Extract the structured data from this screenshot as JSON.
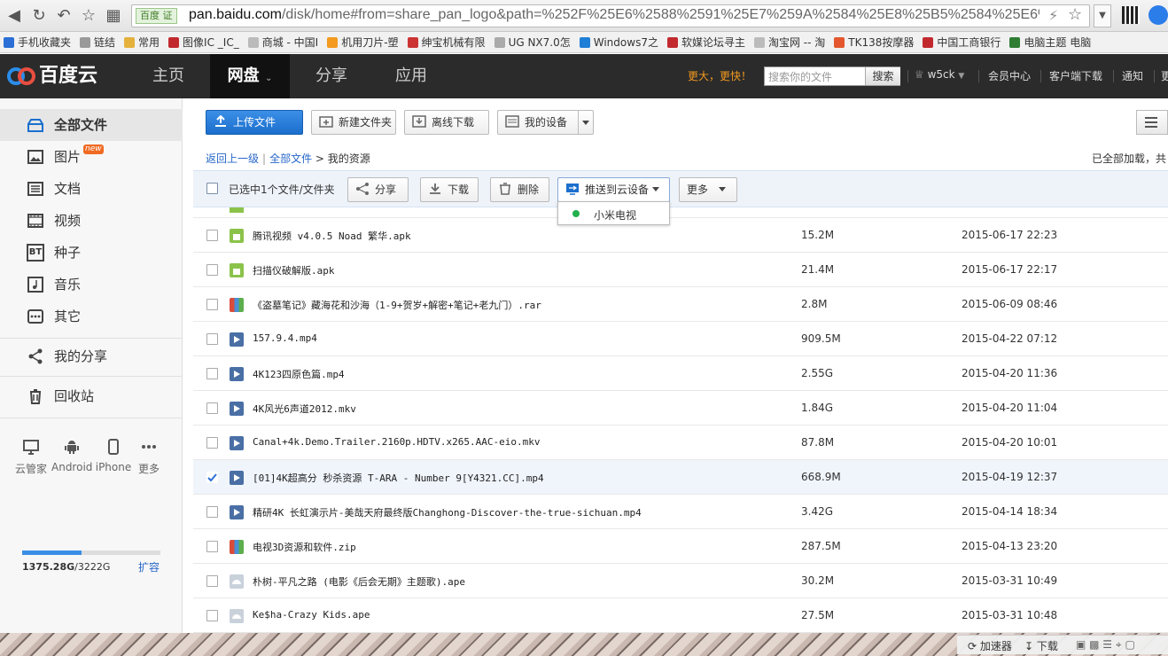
{
  "browser": {
    "url_badge": "百度 证",
    "url_host": "pan.baidu.com",
    "url_rest": "/disk/home#from=share_pan_logo&path=%252F%25E6%2588%2591%25E7%259A%2584%25E8%25B5%2584%25E6%",
    "bookmarks": [
      "手机收藏夹",
      "链结",
      "常用",
      "图像IC _IC_",
      "商城 - 中国I",
      "机用刀片-塑",
      "绅宝机械有限",
      "UG NX7.0怎",
      "Windows7之",
      "软媒论坛寻主",
      "淘宝网 -- 淘",
      "TK138按摩器",
      "中国工商银行",
      "电脑主题 电脑"
    ]
  },
  "header": {
    "logo_text": "百度云",
    "nav": [
      "主页",
      "网盘",
      "分享",
      "应用"
    ],
    "active_nav": "网盘",
    "promo": "更大，更快！",
    "search_placeholder": "搜索你的文件",
    "search_button": "搜索",
    "username": "w5ck",
    "links": [
      "会员中心",
      "客户端下载",
      "通知",
      "更"
    ]
  },
  "sidebar": {
    "items": [
      {
        "label": "全部文件",
        "icon": "folder-icon",
        "active": true
      },
      {
        "label": "图片",
        "icon": "image-icon",
        "badge": "new"
      },
      {
        "label": "文档",
        "icon": "document-icon"
      },
      {
        "label": "视频",
        "icon": "video-icon"
      },
      {
        "label": "种子",
        "icon": "bt-icon",
        "icon_text": "BT"
      },
      {
        "label": "音乐",
        "icon": "music-icon"
      },
      {
        "label": "其它",
        "icon": "more-icon"
      }
    ],
    "share": "我的分享",
    "trash": "回收站",
    "devices": [
      "云管家",
      "Android",
      "iPhone",
      "更多"
    ],
    "quota_used": "1375.28G",
    "quota_total": "/3222G",
    "quota_fraction": 0.427,
    "expand": "扩容"
  },
  "toolbar": {
    "upload": "上传文件",
    "new_folder": "新建文件夹",
    "offline": "离线下载",
    "my_devices": "我的设备"
  },
  "breadcrumb": {
    "back": "返回上一级",
    "all": "全部文件",
    "sep": ">",
    "current": "我的资源",
    "loaded": "已全部加载，共"
  },
  "actionbar": {
    "selected": "已选中1个文件/文件夹",
    "share": "分享",
    "download": "下载",
    "delete": "删除",
    "push": "推送到云设备",
    "more": "更多"
  },
  "push_menu": {
    "item": "小米电视"
  },
  "files": [
    {
      "name": "腾讯视频 v4.0.5 Noad 繁华.apk",
      "size": "15.2M",
      "date": "2015-06-17 22:23",
      "type": "apk",
      "checked": false
    },
    {
      "name": "扫描仪破解版.apk",
      "size": "21.4M",
      "date": "2015-06-17 22:17",
      "type": "apk",
      "checked": false
    },
    {
      "name": "《盗墓笔记》藏海花和沙海（1-9+贺岁+解密+笔记+老九门）.rar",
      "size": "2.8M",
      "date": "2015-06-09 08:46",
      "type": "archive",
      "checked": false
    },
    {
      "name": "157.9.4.mp4",
      "size": "909.5M",
      "date": "2015-04-22 07:12",
      "type": "video",
      "checked": false
    },
    {
      "name": "4K123四原色篇.mp4",
      "size": "2.55G",
      "date": "2015-04-20 11:36",
      "type": "video",
      "checked": false
    },
    {
      "name": "4K风光6声道2012.mkv",
      "size": "1.84G",
      "date": "2015-04-20 11:04",
      "type": "video",
      "checked": false
    },
    {
      "name": "Canal+4k.Demo.Trailer.2160p.HDTV.x265.AAC-eio.mkv",
      "size": "87.8M",
      "date": "2015-04-20 10:01",
      "type": "video",
      "checked": false
    },
    {
      "name": "[01]4K超高分 秒杀资源 T-ARA - Number 9[Y4321.CC].mp4",
      "size": "668.9M",
      "date": "2015-04-19 12:37",
      "type": "video",
      "checked": true
    },
    {
      "name": "精研4K 长虹演示片-美哉天府最终版Changhong-Discover-the-true-sichuan.mp4",
      "size": "3.42G",
      "date": "2015-04-14 18:34",
      "type": "video",
      "checked": false
    },
    {
      "name": "电视3D资源和软件.zip",
      "size": "287.5M",
      "date": "2015-04-13 23:20",
      "type": "archive",
      "checked": false
    },
    {
      "name": "朴树-平凡之路 (电影《后会无期》主题歌).ape",
      "size": "30.2M",
      "date": "2015-03-31 10:49",
      "type": "audio",
      "checked": false
    },
    {
      "name": "Ke$ha-Crazy Kids.ape",
      "size": "27.5M",
      "date": "2015-03-31 10:48",
      "type": "audio",
      "checked": false
    }
  ],
  "statusbar": {
    "accelerator": "加速器",
    "download": "下载"
  },
  "colors": {
    "accent": "#1b6fcd",
    "apk": "#8bc34a",
    "video": "#4a6fa5",
    "audio": "#c9d1db",
    "archive": "#e0a030",
    "topbar": "#2b2b2b",
    "promo": "#f39a1f"
  }
}
